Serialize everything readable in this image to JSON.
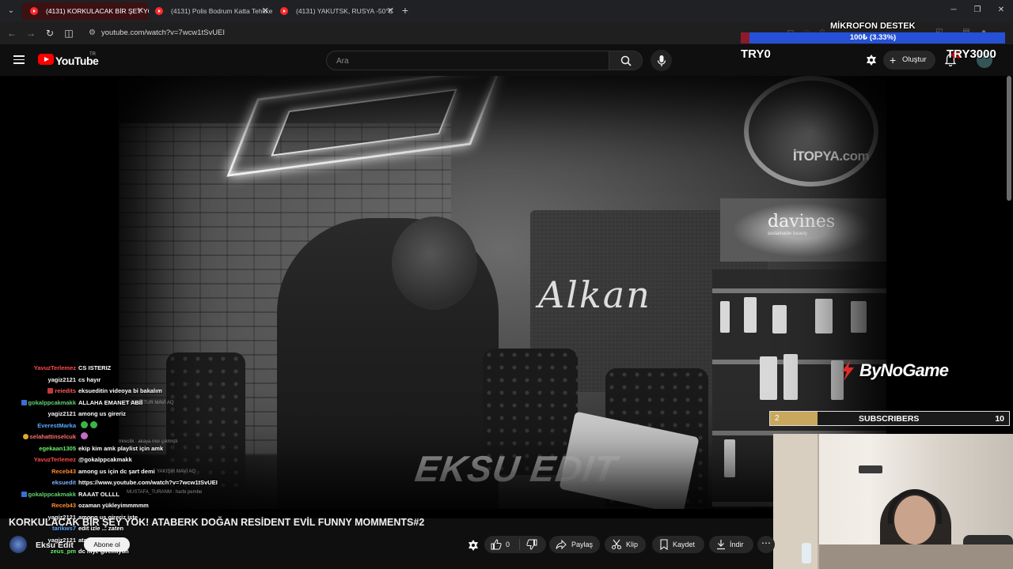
{
  "browser": {
    "tabs": [
      {
        "title": "(4131) KORKULACAK BİR ŞEY YOK!",
        "active": true
      },
      {
        "title": "(4131) Polis Bodrum Katta Tehlike",
        "active": false
      },
      {
        "title": "(4131) YAKUTSK, RUSYA -50°C",
        "active": false
      }
    ],
    "url": "youtube.com/watch?v=7wcw1tSvUEI"
  },
  "youtube": {
    "logo_text": "YouTube",
    "country": "TR",
    "search_placeholder": "Ara",
    "create_label": "Oluştur",
    "notification_count": "9+"
  },
  "overlay": {
    "donation_title": "MİKROFON DESTEK",
    "donation_progress": "100₺ (3.33%)",
    "donation_fraction": 0.0333,
    "left_label": "TRY0",
    "right_label": "TRY3000",
    "sponsor": "ByNoGame",
    "subs_current": "2",
    "subs_label": "SUBSCRIBERS",
    "subs_goal": "10",
    "subs_fraction": 0.2
  },
  "video": {
    "clock_watermark": "İTOPYA.com",
    "shelf_brand": "davines",
    "shelf_tagline": "sustainable beauty",
    "script_sign": "Alkan",
    "edit_watermark": "EKSU EDIT"
  },
  "chat": [
    {
      "name": "YavuzTerlemez",
      "color": "#ff4b4b",
      "badge": "",
      "msg": "CS ISTERIZ"
    },
    {
      "name": "yagiz2121",
      "color": "#f6f6f6",
      "badge": "",
      "msg": "cs hayır"
    },
    {
      "name": "reiedits",
      "color": "#ff5a5a",
      "badge": "sub",
      "msg": "eksueditin videoya bi bakalım"
    },
    {
      "name": "gokalppcakmakk",
      "color": "#62d36a",
      "badge": "mod",
      "msg": "ALLAHA EMANET ABİİ"
    },
    {
      "name": "yagiz2121",
      "color": "#f6f6f6",
      "badge": "",
      "msg": "among us gireriz"
    },
    {
      "name": "EverestMarka",
      "color": "#5aa9ff",
      "badge": "",
      "msg": "",
      "emotes": 2
    },
    {
      "name": "selahattinselcuk",
      "color": "#ff6f6f",
      "badge": "vip",
      "msg": "",
      "emotes": 1
    },
    {
      "name": "egekaan1305",
      "color": "#6df06d",
      "badge": "",
      "msg": "ekip kim amk playlist için amk"
    },
    {
      "name": "YavuzTerlemez",
      "color": "#ff4b4b",
      "badge": "",
      "msg": "@gokalppcakmakk"
    },
    {
      "name": "Receb43",
      "color": "#ff8c2e",
      "badge": "",
      "msg": "among us için dc şart demi"
    },
    {
      "name": "eksuedit",
      "color": "#7fb0ff",
      "badge": "",
      "msg": "https://www.youtube.com/watch?v=7wcw1tSvUEI"
    },
    {
      "name": "gokalppcakmakk",
      "color": "#62d36a",
      "badge": "mod",
      "msg": "RAAAT OLLLL"
    },
    {
      "name": "Receb43",
      "color": "#ff8c2e",
      "badge": "",
      "msg": "ozaman yükleyimmmmm"
    },
    {
      "name": "yagiz2121",
      "color": "#f6f6f6",
      "badge": "",
      "msg": "among us gireriz iste"
    },
    {
      "name": "tarikws7",
      "color": "#5aa9ff",
      "badge": "",
      "msg": "edit izle ... zaten"
    },
    {
      "name": "yagiz2121",
      "color": "#f6f6f6",
      "badge": "",
      "msg": "ata"
    },
    {
      "name": "zeus_pm",
      "color": "#6df06d",
      "badge": "",
      "msg": "dc niye giremiyon"
    }
  ],
  "ghost_chat": [
    "1 OLUŞTUR MAVİ AQ",
    "mrecibi : akaya mor çıkmıştı",
    "YAKIŞIR MAVİ AQ",
    "MUSTAFA_TURANM : harbi pembe"
  ],
  "info": {
    "title": "KORKULACAK BİR ŞEY YOK! ATABERK DOĞAN RESİDENT EVİL FUNNY MOMMENTS#2",
    "channel": "Eksu Edit",
    "subscribe": "Abone ol",
    "likes": "0",
    "share": "Paylaş",
    "clip": "Klip",
    "save": "Kaydet",
    "download": "İndir"
  }
}
